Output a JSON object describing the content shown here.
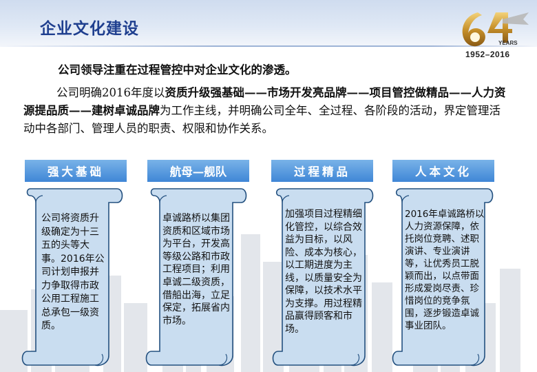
{
  "header": {
    "title": "企业文化建设",
    "logo_years": "YEARS",
    "logo_range": "1952–2016"
  },
  "intro": {
    "lead": "公司领导注重在过程管控中对企业文化的渗透。",
    "body_prefix": "公司明确2016年度以",
    "body_bold": "资质升级强基础——市场开发亮品牌——项目管控做精品——人力资源提品质——建树卓诚品牌",
    "body_suffix": "为工作主线，并明确公司全年、全过程、各阶段的活动，界定管理活动中各部门、管理人员的职责、权限和协作关系。"
  },
  "sections": [
    {
      "tab": "强大基础",
      "text": "公司将资质升级确定为十三五的头等大事。2016年公司计划申报并力争取得市政公用工程施工总承包一级资质。"
    },
    {
      "tab": "航母—舰队",
      "text": "卓诚路桥以集团资质和区域市场为平台，开发高等级公路和市政工程项目；利用卓诚二级资质，借船出海，立足保定，拓展省内市场。"
    },
    {
      "tab": "过程精品",
      "text": "加强项目过程精细化管控，以综合效益为目标，以风险、成本为核心，以工期进度为主线，以质量安全为保障，以技术水平为支撑。用过程精品赢得顾客和市场。"
    },
    {
      "tab": "人本文化",
      "text": "2016年卓诚路桥以人力资源保障，依托岗位竞聘、述职演讲、专业演讲等，让优秀员工脱颖而出，以点带面形成爱岗尽责、珍惜岗位的竞争氛围，逐步锻造卓诚事业团队。"
    }
  ],
  "colors": {
    "title": "#1f3f8f",
    "tab": "#3f86d6",
    "scroll_fill": "#c9ddf0",
    "scroll_stroke": "#23507f"
  }
}
